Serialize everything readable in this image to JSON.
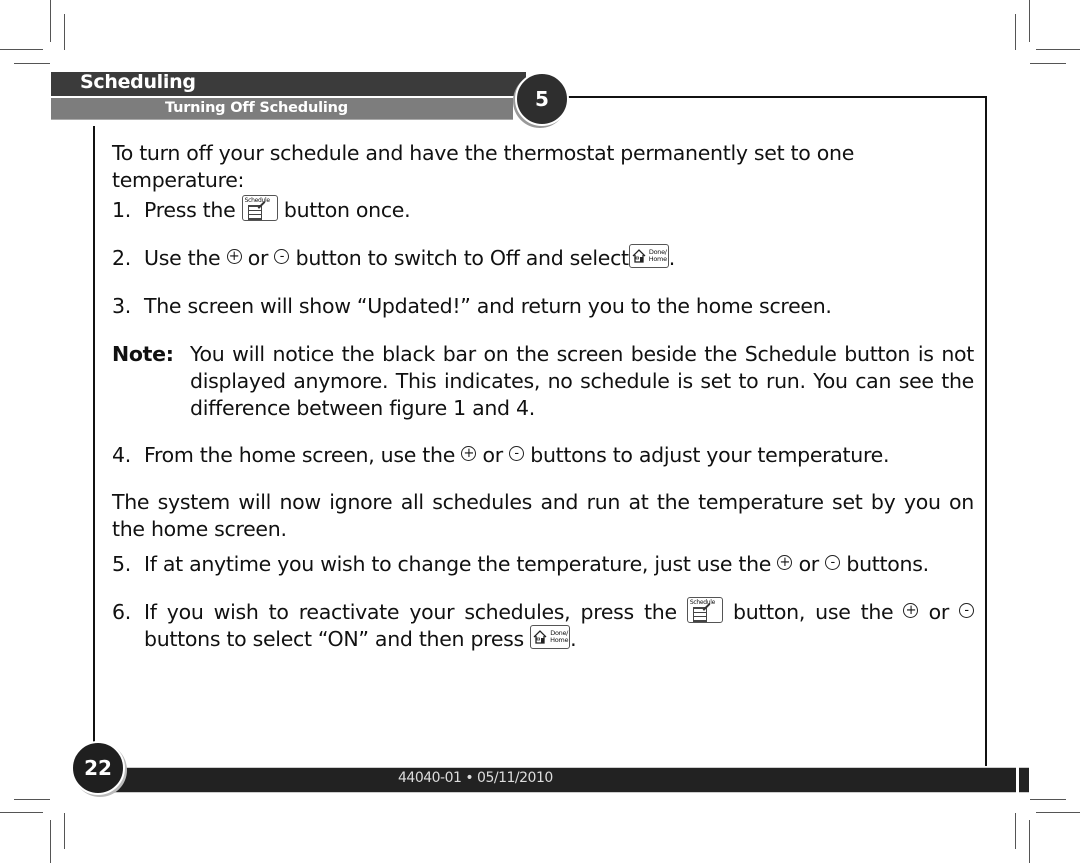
{
  "header": {
    "section_title": "Scheduling",
    "subsection_title": "Turning Off Scheduling",
    "chapter_number": "5"
  },
  "content": {
    "intro": "To turn off your schedule and have the thermostat permanently set to one temperature:",
    "steps": [
      {
        "num": "1.",
        "parts": [
          "Press the",
          "button once."
        ]
      },
      {
        "num": "2.",
        "parts": [
          "Use the",
          "or",
          "button to switch to Off and select",
          "."
        ]
      },
      {
        "num": "3.",
        "parts": [
          "The screen will show “Updated!” and return you to the home screen."
        ]
      },
      {
        "num": "4.",
        "parts": [
          "From the home screen, use the",
          "or",
          "buttons to adjust your temperature."
        ]
      },
      {
        "num": "5.",
        "parts": [
          "If at anytime you wish to change the temperature, just use the",
          "or",
          "buttons."
        ]
      },
      {
        "num": "6.",
        "parts": [
          "If you wish to reactivate your schedules, press the",
          "button, use the",
          "or",
          "buttons to select “ON” and then press",
          "."
        ]
      }
    ],
    "note_label": "Note:",
    "note_text": "You will notice the black bar on the screen beside the Schedule button is not displayed anymore. This indicates, no schedule is set to run. You can see the difference between figure 1 and 4.",
    "system_para": "The system will now ignore all schedules and run at the temperature set by you on the home screen."
  },
  "icons": {
    "schedule_button_label": "Schedule",
    "plus_glyph": "+",
    "minus_glyph": "-",
    "done_home_label_1": "Done/",
    "done_home_label_2": "Home"
  },
  "footer": {
    "page_number": "22",
    "doc_code": "44040-01 • 05/11/2010"
  }
}
